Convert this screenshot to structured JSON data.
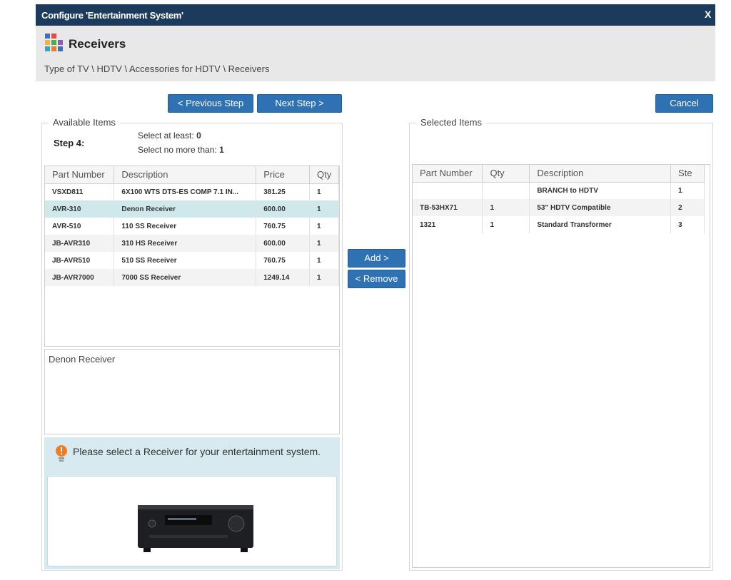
{
  "window": {
    "title": "Configure 'Entertainment System'",
    "close": "X"
  },
  "header": {
    "heading": "Receivers",
    "breadcrumb": "Type of TV \\ HDTV \\ Accessories for HDTV \\ Receivers"
  },
  "buttons": {
    "previous": "< Previous Step",
    "next": "Next Step >",
    "cancel": "Cancel",
    "add": "Add >",
    "remove": "< Remove"
  },
  "available": {
    "legend": "Available Items",
    "step_label": "Step 4:",
    "min_label": "Select at least:",
    "min_value": "0",
    "max_label": "Select no more than:",
    "max_value": "1",
    "columns": [
      "Part Number",
      "Description",
      "Price",
      "Qty"
    ],
    "rows": [
      [
        "VSXD811",
        "6X100 WTS DTS-ES COMP 7.1 IN...",
        "381.25",
        "1"
      ],
      [
        "AVR-310",
        "Denon Receiver",
        "600.00",
        "1"
      ],
      [
        "AVR-510",
        "110 SS Receiver",
        "760.75",
        "1"
      ],
      [
        "JB-AVR310",
        "310 HS Receiver",
        "600.00",
        "1"
      ],
      [
        "JB-AVR510",
        "510 SS Receiver",
        "760.75",
        "1"
      ],
      [
        "JB-AVR7000",
        "7000 SS Receiver",
        "1249.14",
        "1"
      ]
    ],
    "selected_row": 1,
    "detail_text": "Denon Receiver",
    "notice": "Please select a Receiver for your entertainment system."
  },
  "selected": {
    "legend": "Selected Items",
    "columns": [
      "Part Number",
      "Qty",
      "Description",
      "Ste"
    ],
    "rows": [
      [
        "",
        "",
        "BRANCH to HDTV",
        "1"
      ],
      [
        "TB-53HX71",
        "1",
        "53\" HDTV Compatible",
        "2"
      ],
      [
        "1321",
        "1",
        "Standard Transformer",
        "3"
      ]
    ]
  },
  "colors": {
    "title_bar": "#1b3a5c",
    "button": "#2e72b3",
    "selection": "#cfe8ec",
    "notice_bg": "#d6eaf0"
  },
  "icons": {
    "header": "components-icon",
    "notice": "lightbulb-icon"
  }
}
